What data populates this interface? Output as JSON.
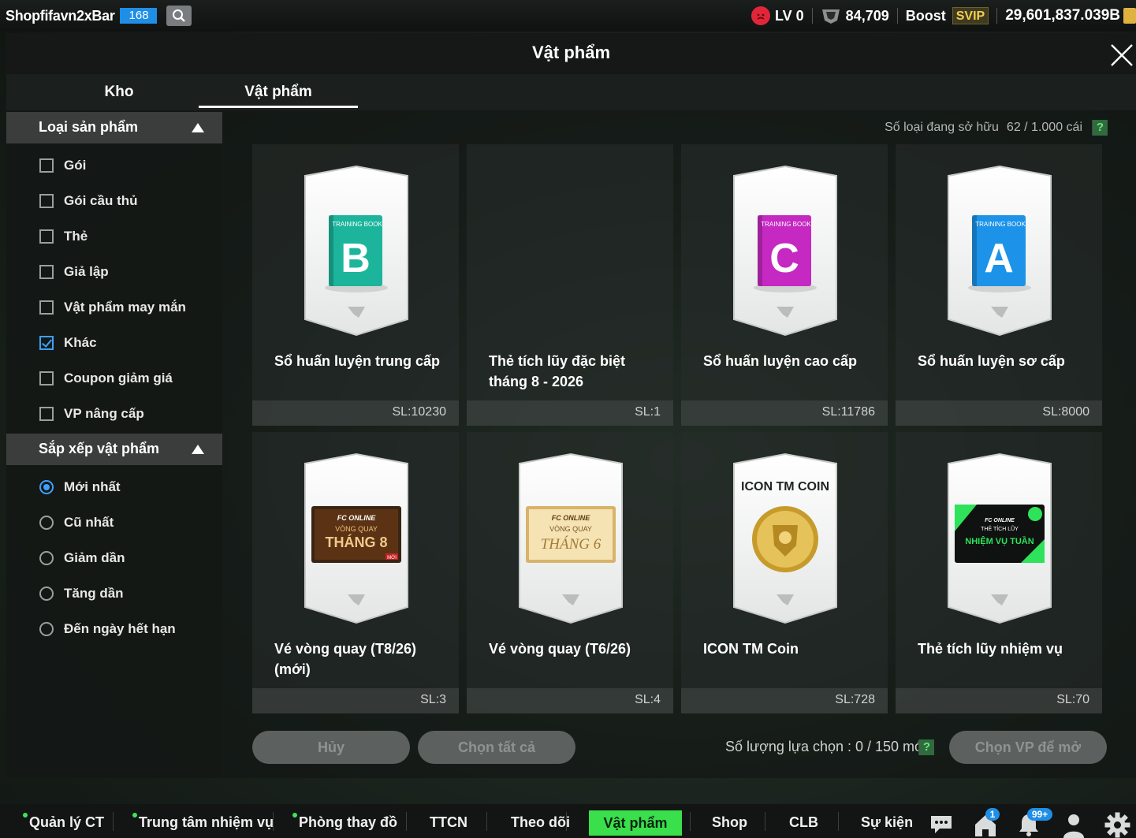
{
  "topbar": {
    "username": "Shopfifavn2xBar",
    "user_level": "168",
    "lv_label": "LV 0",
    "bp_value": "84,709",
    "boost_label": "Boost",
    "svip_label": "SVIP",
    "coin_value": "29,601,837.039B"
  },
  "modal": {
    "title": "Vật phẩm",
    "tabs": [
      {
        "label": "Kho",
        "active": false
      },
      {
        "label": "Vật phẩm",
        "active": true
      }
    ]
  },
  "sidebar": {
    "category_title": "Loại sản phẩm",
    "categories": [
      {
        "label": "Gói",
        "checked": false
      },
      {
        "label": "Gói cầu thủ",
        "checked": false
      },
      {
        "label": "Thẻ",
        "checked": false
      },
      {
        "label": "Giả lập",
        "checked": false
      },
      {
        "label": "Vật phẩm may mắn",
        "checked": false
      },
      {
        "label": "Khác",
        "checked": true
      },
      {
        "label": "Coupon giảm giá",
        "checked": false
      },
      {
        "label": "VP nâng cấp",
        "checked": false
      }
    ],
    "sort_title": "Sắp xếp vật phẩm",
    "sorts": [
      {
        "label": "Mới nhất",
        "selected": true
      },
      {
        "label": "Cũ nhất",
        "selected": false
      },
      {
        "label": "Giảm dần",
        "selected": false
      },
      {
        "label": "Tăng dần",
        "selected": false
      },
      {
        "label": "Đến ngày hết hạn",
        "selected": false
      }
    ]
  },
  "inventory": {
    "owned_label": "Số loại đang sở hữu",
    "owned_count": "62 / 1.000 cái",
    "help": "?",
    "items": [
      {
        "name": "Sổ huấn luyện trung cấp",
        "qty": "SL:10230",
        "thumb": "training-book-b",
        "book_title": "TRAINING BOOK",
        "letter": "B",
        "color": "#1cb59c"
      },
      {
        "name": "Thẻ tích lũy đặc biệt tháng 8 - 2026",
        "qty": "SL:1",
        "thumb": "empty"
      },
      {
        "name": "Sổ huấn luyện cao cấp",
        "qty": "SL:11786",
        "thumb": "training-book-c",
        "book_title": "TRAINING BOOK",
        "letter": "C",
        "color": "#c628c2"
      },
      {
        "name": "Sổ huấn luyện sơ cấp",
        "qty": "SL:8000",
        "thumb": "training-book-a",
        "book_title": "TRAINING BOOK",
        "letter": "A",
        "color": "#1c93e8"
      },
      {
        "name": "Vé vòng quay (T8/26) (mới)",
        "qty": "SL:3",
        "thumb": "spin-ticket-aug",
        "ticket_brand": "FC ONLINE",
        "ticket_sub": "VÒNG QUAY",
        "ticket_month": "THÁNG 8",
        "ticket_badge": "MỚI"
      },
      {
        "name": "Vé vòng quay (T6/26)",
        "qty": "SL:4",
        "thumb": "spin-ticket-jun",
        "ticket_brand": "FC ONLINE",
        "ticket_sub": "VÒNG QUAY",
        "ticket_month": "THÁNG 6"
      },
      {
        "name": "ICON TM Coin",
        "qty": "SL:728",
        "thumb": "icon-tm-coin",
        "coin_caption": "ICON TM COIN"
      },
      {
        "name": "Thẻ tích lũy nhiệm vụ",
        "qty": "SL:70",
        "thumb": "mission-card",
        "mission_brand": "FC ONLINE",
        "mission_sub": "THẺ TÍCH LŨY",
        "mission_title": "NHIỆM VỤ TUẦN"
      }
    ],
    "cancel_label": "Hủy",
    "select_all_label": "Chọn tất cả",
    "selection_text": "Số lượng lựa chọn : 0 / 150 món",
    "open_label": "Chọn VP để mở"
  },
  "bottomnav": {
    "items": [
      {
        "label": "Quản lý CT",
        "dot": true
      },
      {
        "label": "Trung tâm nhiệm vụ",
        "dot": true
      },
      {
        "label": "Phòng thay đồ",
        "dot": true
      },
      {
        "label": "TTCN",
        "dot": false
      },
      {
        "label": "Theo dõi",
        "dot": false
      },
      {
        "label": "Vật phẩm",
        "dot": false,
        "active": true
      },
      {
        "label": "Shop",
        "dot": false
      },
      {
        "label": "CLB",
        "dot": false
      },
      {
        "label": "Sự kiện",
        "dot": false
      }
    ],
    "home_badge": "1",
    "bell_badge": "99+",
    "accent": "#39e04b"
  }
}
